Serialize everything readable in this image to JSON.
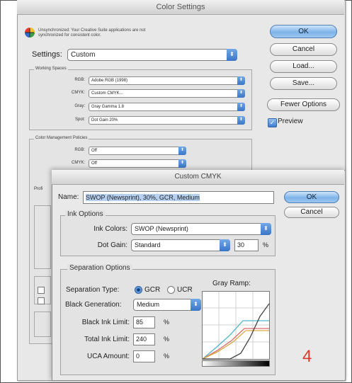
{
  "color_settings": {
    "title": "Color Settings",
    "message": "Unsynchronized: Your Creative Suite applications are not synchronized for consistent color.",
    "settings_label": "Settings:",
    "settings_value": "Custom",
    "working_spaces": {
      "label": "Working Spaces",
      "rows": [
        {
          "label": "RGB:",
          "value": "Adobe RGB (1998)"
        },
        {
          "label": "CMYK:",
          "value": "Custom CMYK..."
        },
        {
          "label": "Gray:",
          "value": "Gray Gamma 1.8"
        },
        {
          "label": "Spot:",
          "value": "Dot Gain 20%"
        }
      ]
    },
    "policies": {
      "label": "Color Management Policies",
      "rows": [
        {
          "label": "RGB:",
          "value": "Off"
        },
        {
          "label": "CMYK:",
          "value": "Off"
        }
      ],
      "partial_label": "Profi"
    },
    "buttons": {
      "ok": "OK",
      "cancel": "Cancel",
      "load": "Load...",
      "save": "Save...",
      "fewer": "Fewer Options"
    },
    "preview_label": "Preview"
  },
  "custom_cmyk": {
    "title": "Custom CMYK",
    "name_label": "Name:",
    "name_value": "SWOP (Newsprint), 30%, GCR, Medium",
    "ok": "OK",
    "cancel": "Cancel",
    "ink_options": {
      "label": "Ink Options",
      "ink_colors_label": "Ink Colors:",
      "ink_colors_value": "SWOP (Newsprint)",
      "dot_gain_label": "Dot Gain:",
      "dot_gain_value": "Standard",
      "dot_gain_amount": "30",
      "percent": "%"
    },
    "separation": {
      "label": "Separation Options",
      "type_label": "Separation Type:",
      "gcr": "GCR",
      "ucr": "UCR",
      "selected": "GCR",
      "gray_ramp_label": "Gray Ramp:",
      "black_gen_label": "Black Generation:",
      "black_gen_value": "Medium",
      "black_ink_label": "Black Ink Limit:",
      "black_ink_value": "85",
      "total_ink_label": "Total Ink Limit:",
      "total_ink_value": "240",
      "uca_label": "UCA Amount:",
      "uca_value": "0",
      "percent": "%"
    }
  },
  "step_number": "4",
  "colors": {
    "accent_blue": "#3b76c8",
    "step_number_red": "#e03a2e",
    "curve_cyan": "#4fb6c9",
    "curve_magenta": "#d66a6a",
    "curve_yellow": "#d9a640",
    "curve_black": "#444444"
  }
}
